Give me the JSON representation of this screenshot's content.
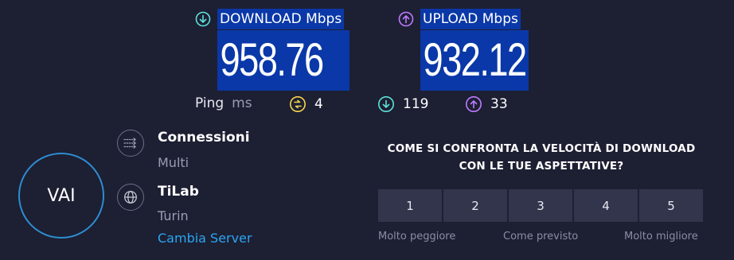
{
  "download": {
    "label": "DOWNLOAD Mbps",
    "value": "958.76",
    "icon": "download-arrow-icon",
    "color": "#5ee0d8"
  },
  "upload": {
    "label": "UPLOAD Mbps",
    "value": "932.12",
    "icon": "upload-arrow-icon",
    "color": "#bd7aff"
  },
  "ping": {
    "label": "Ping",
    "unit": "ms",
    "idle": "4",
    "download": "119",
    "upload": "33",
    "idle_color": "#f2d44a"
  },
  "server": {
    "badge": "VAI",
    "connections_title": "Connessioni",
    "connections_value": "Multi",
    "host_title": "TiLab",
    "host_location": "Turin",
    "change_server": "Cambia Server"
  },
  "rating": {
    "question_line1": "COME SI CONFRONTA LA VELOCITÀ DI DOWNLOAD",
    "question_line2": "CON LE TUE ASPETTATIVE?",
    "options": [
      "1",
      "2",
      "3",
      "4",
      "5"
    ],
    "caption_low": "Molto peggiore",
    "caption_mid": "Come previsto",
    "caption_high": "Molto migliore"
  }
}
